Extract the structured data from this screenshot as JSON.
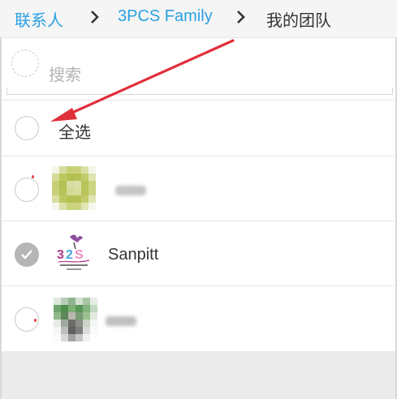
{
  "breadcrumb": {
    "items": [
      {
        "label": "联系人",
        "type": "link"
      },
      {
        "label": "3PCS Family",
        "type": "link"
      },
      {
        "label": "我的团队",
        "type": "current"
      }
    ],
    "separator_icon": "chevron-right-icon"
  },
  "search": {
    "placeholder": "搜索",
    "icon": "selection-circle-icon"
  },
  "select_all": {
    "label": "全选",
    "checked": false
  },
  "contacts": [
    {
      "name": "",
      "checked": false,
      "avatar": "blurred-photo"
    },
    {
      "name": "Sanpitt",
      "checked": true,
      "avatar": "3pcs-family-shop-logo"
    },
    {
      "name": "",
      "checked": false,
      "avatar": "blurred-photo"
    }
  ],
  "annotation": {
    "type": "arrow",
    "color": "#e0303a",
    "target": "select-all-checkbox"
  },
  "colors": {
    "link": "#29a1e3",
    "text": "#333333",
    "placeholder": "#b3b3b3",
    "checked": "#b5b5b5"
  }
}
